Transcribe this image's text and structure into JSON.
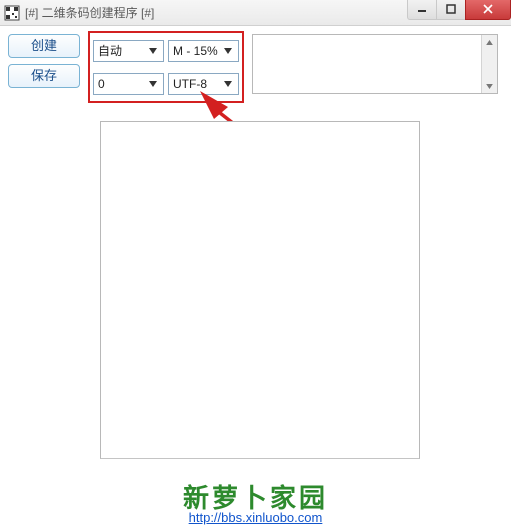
{
  "window": {
    "title": "[#] 二维条码创建程序 [#]"
  },
  "buttons": {
    "create": "创建",
    "save": "保存"
  },
  "dropdowns": {
    "mode": "自动",
    "ecc": "M - 15%",
    "version": "0",
    "encoding": "UTF-8"
  },
  "textbox": {
    "value": ""
  },
  "footer": {
    "brand": "新萝卜家园",
    "url": "http://bbs.xinluobo.com"
  },
  "colors": {
    "highlight": "#d32020",
    "brand_green": "#2d8a2d",
    "link": "#1155cc"
  }
}
